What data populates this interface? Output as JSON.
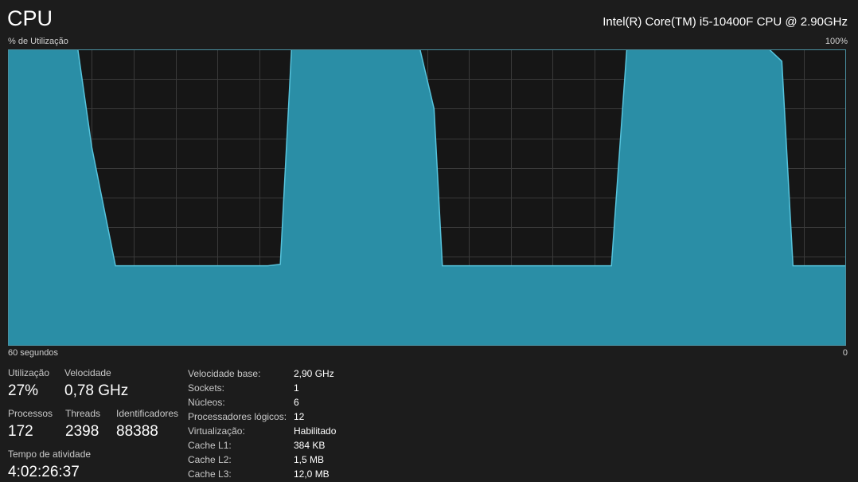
{
  "header": {
    "title": "CPU",
    "model": "Intel(R) Core(TM) i5-10400F CPU @ 2.90GHz"
  },
  "graph": {
    "y_label": "% de Utilização",
    "y_max_label": "100%",
    "x_label": "60 segundos",
    "x_min_label": "0",
    "fill_color": "#2a8ea6",
    "line_color": "#56c3dc",
    "grid_color": "#3a3a3a"
  },
  "chart_data": {
    "type": "area",
    "xlim": [
      60,
      0
    ],
    "ylim": [
      0,
      100
    ],
    "points": [
      [
        60,
        100
      ],
      [
        55,
        100
      ],
      [
        54,
        67
      ],
      [
        52.3,
        27
      ],
      [
        41.4,
        27
      ],
      [
        40.5,
        27.5
      ],
      [
        39.7,
        100
      ],
      [
        30.5,
        100
      ],
      [
        29.5,
        80
      ],
      [
        28.9,
        27
      ],
      [
        16.8,
        27
      ],
      [
        15.7,
        100
      ],
      [
        5.5,
        100
      ],
      [
        4.6,
        96
      ],
      [
        3.8,
        27
      ],
      [
        0,
        27
      ]
    ],
    "grid": true
  },
  "stats": {
    "utilization": {
      "label": "Utilização",
      "value": "27%"
    },
    "speed": {
      "label": "Velocidade",
      "value": "0,78 GHz"
    },
    "processes": {
      "label": "Processos",
      "value": "172"
    },
    "threads": {
      "label": "Threads",
      "value": "2398"
    },
    "handles": {
      "label": "Identificadores",
      "value": "88388"
    },
    "uptime": {
      "label": "Tempo de atividade",
      "value": "4:02:26:37"
    }
  },
  "details": [
    {
      "key": "Velocidade base:",
      "value": "2,90 GHz"
    },
    {
      "key": "Sockets:",
      "value": "1"
    },
    {
      "key": "Núcleos:",
      "value": "6"
    },
    {
      "key": "Processadores lógicos:",
      "value": "12"
    },
    {
      "key": "Virtualização:",
      "value": "Habilitado"
    },
    {
      "key": "Cache L1:",
      "value": "384 KB"
    },
    {
      "key": "Cache L2:",
      "value": "1,5 MB"
    },
    {
      "key": "Cache L3:",
      "value": "12,0 MB"
    }
  ]
}
